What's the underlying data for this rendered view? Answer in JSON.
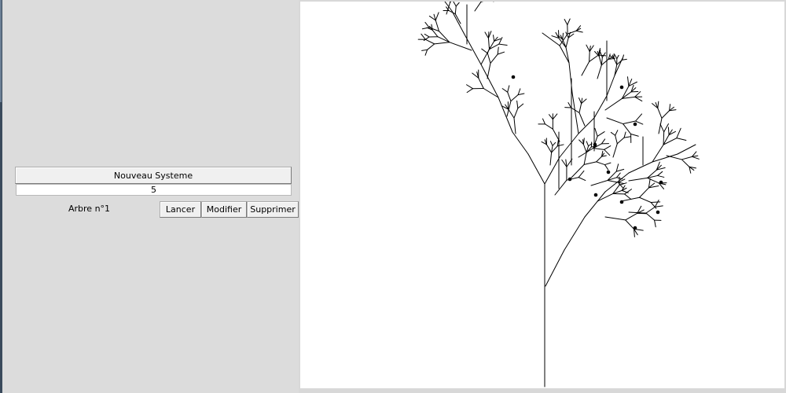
{
  "controls": {
    "new_system_label": "Nouveau Systeme",
    "depth_value": "5"
  },
  "tree_entry": {
    "label": "Arbre n°1",
    "launch_label": "Lancer",
    "modify_label": "Modifier",
    "delete_label": "Supprimer"
  },
  "canvas": {
    "background": "#ffffff",
    "stroke_color": "#000000"
  }
}
